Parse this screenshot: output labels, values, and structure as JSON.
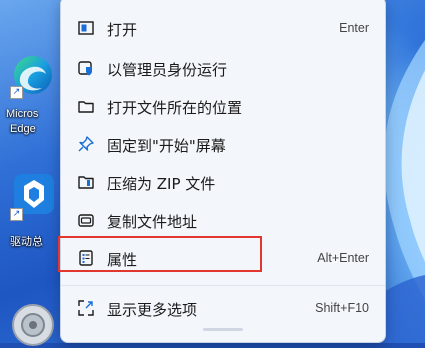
{
  "desktop": {
    "icons": [
      {
        "name": "edge",
        "label_line1": "Micros",
        "label_line2": "Edge"
      },
      {
        "name": "driver",
        "label_line1": "驱动总"
      }
    ]
  },
  "menu": {
    "items": [
      {
        "id": "open",
        "icon": "open-window-icon",
        "label": "打开",
        "shortcut": "Enter"
      },
      {
        "id": "run-as-admin",
        "icon": "shield-icon",
        "label": "以管理员身份运行",
        "shortcut": ""
      },
      {
        "id": "open-file-location",
        "icon": "folder-icon",
        "label": "打开文件所在的位置",
        "shortcut": ""
      },
      {
        "id": "pin-to-start",
        "icon": "pin-icon",
        "label": "固定到\"开始\"屏幕",
        "shortcut": ""
      },
      {
        "id": "compress-zip",
        "icon": "zip-folder-icon",
        "label": "压缩为 ZIP 文件",
        "shortcut": ""
      },
      {
        "id": "copy-path",
        "icon": "copy-path-icon",
        "label": "复制文件地址",
        "shortcut": ""
      },
      {
        "id": "properties",
        "icon": "properties-icon",
        "label": "属性",
        "shortcut": "Alt+Enter"
      },
      {
        "id": "show-more-options",
        "icon": "expand-icon",
        "label": "显示更多选项",
        "shortcut": "Shift+F10"
      }
    ]
  },
  "colors": {
    "accent": "#1a6fd6",
    "highlight_border": "#e2372f",
    "menu_bg": "#f3f6fb"
  }
}
